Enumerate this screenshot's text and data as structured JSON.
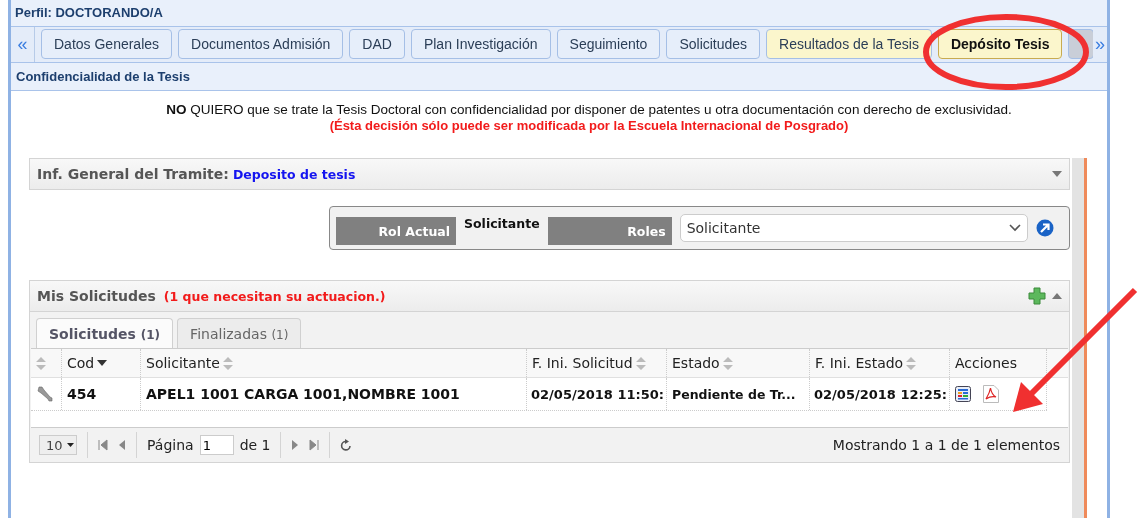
{
  "profile": {
    "title": "Perfil: DOCTORANDO/A"
  },
  "tabs_nav": {
    "prev": "«",
    "next": "»"
  },
  "tabs": [
    {
      "label": "Datos Generales",
      "selected": false,
      "color": "#e6eefa"
    },
    {
      "label": "Documentos Admisión",
      "selected": false,
      "color": "#e6eefa"
    },
    {
      "label": "DAD",
      "selected": false,
      "color": "#e6eefa"
    },
    {
      "label": "Plan Investigación",
      "selected": false,
      "color": "#e6eefa"
    },
    {
      "label": "Seguimiento",
      "selected": false,
      "color": "#e6eefa"
    },
    {
      "label": "Solicitudes",
      "selected": false,
      "color": "#e6eefa"
    },
    {
      "label": "Resultados de la Tesis",
      "selected": false,
      "color": "#fbf6cc"
    },
    {
      "label": "Depósito Tesis",
      "selected": true,
      "color": "#fbf6cc"
    },
    {
      "selected": false,
      "color": "#c9ced8"
    }
  ],
  "section": {
    "title": "Confidencialidad de la Tesis",
    "notice": "**NO** QUIERO que se trate la Tesis Doctoral con confidencialidad por disponer de patentes u otra documentación con derecho de exclusividad.",
    "warning": "(Ésta decisión sólo puede ser modificada por la Escuela Internacional de Posgrado)"
  },
  "info_panel": {
    "label": "Inf. General del Tramite:",
    "value": "Deposito de tesis",
    "expanded": false
  },
  "role_bar": {
    "current_label": "Rol Actual",
    "current_value": "Solicitante",
    "roles_label": "Roles",
    "roles_value": "Solicitante"
  },
  "requests": {
    "title": "Mis Solicitudes",
    "pending_note": "(1  que necesitan su actuacion.)",
    "expanded": true,
    "tabs": [
      {
        "label": "Solicitudes",
        "count": "(1)",
        "selected": true
      },
      {
        "label": "Finalizadas",
        "count": "(1)",
        "selected": false
      }
    ],
    "columns": [
      {
        "kind": "sortable"
      },
      {
        "label": "Cod",
        "kind": "sorted"
      },
      {
        "label": "Solicitante",
        "kind": "sortable"
      },
      {
        "label": "F. Ini. Solicitud",
        "kind": "sortable"
      },
      {
        "label": "Estado",
        "kind": "sortable"
      },
      {
        "label": "F. Ini. Estado",
        "kind": "sortable"
      },
      {
        "label": "Acciones",
        "kind": "plain"
      }
    ],
    "rows": [
      {
        "cells": [
          "",
          "454",
          "APEL1 1001 CARGA 1001,NOMBRE 1001",
          "02/05/2018 11:50:",
          "Pendiente de Tr...",
          "02/05/2018 12:25:"
        ]
      }
    ],
    "pager": {
      "page_size": "10",
      "page_label": "Página",
      "page": "1",
      "of": "de 1",
      "info": "Mostrando 1 a 1 de 1 elementos"
    }
  }
}
